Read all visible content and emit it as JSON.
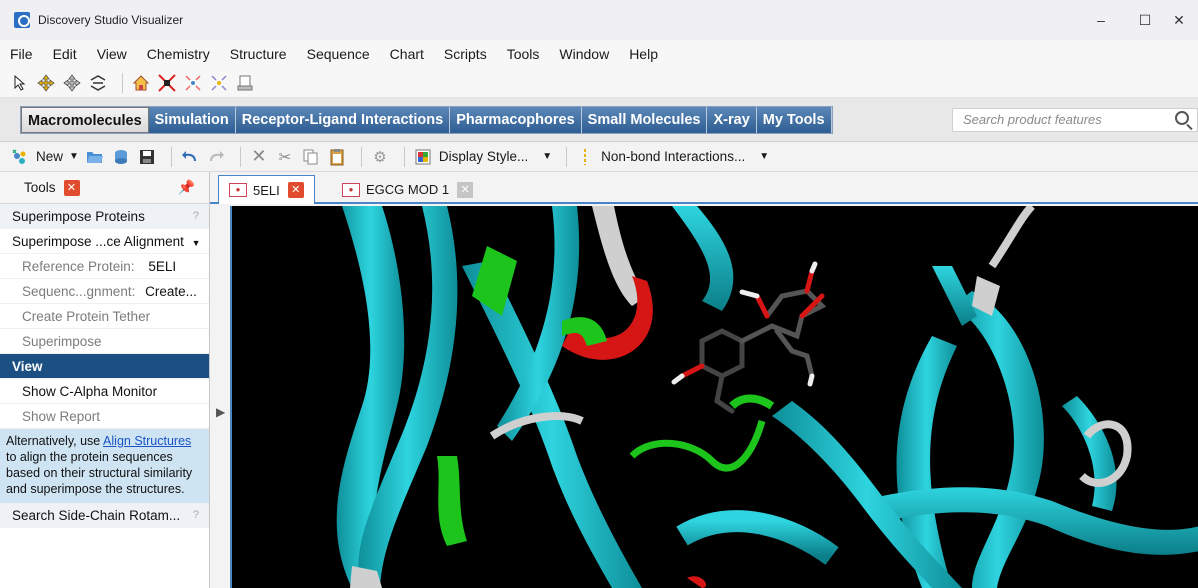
{
  "window": {
    "title": "Discovery Studio Visualizer"
  },
  "window_controls": {
    "minimize": "–",
    "maximize": "☐",
    "close": "✕"
  },
  "menu": [
    "File",
    "Edit",
    "View",
    "Chemistry",
    "Structure",
    "Sequence",
    "Chart",
    "Scripts",
    "Tools",
    "Window",
    "Help"
  ],
  "ribbon": {
    "tabs": [
      "Macromolecules",
      "Simulation",
      "Receptor-Ligand Interactions",
      "Pharmacophores",
      "Small Molecules",
      "X-ray",
      "My Tools"
    ],
    "active_tab": "Macromolecules",
    "search_placeholder": "Search product features"
  },
  "toolbar": {
    "new_label": "New",
    "display_style_label": "Display Style...",
    "nonbond_label": "Non-bond Interactions..."
  },
  "tools_panel": {
    "title": "Tools",
    "section_title": "Superimpose Proteins",
    "method_select": "Superimpose ...ce Alignment",
    "reference_label": "Reference Protein:",
    "reference_value": "5ELI",
    "sequence_label": "Sequenc...gnment:",
    "sequence_value": "Create...",
    "create_tether": "Create Protein Tether",
    "superimpose": "Superimpose",
    "view": "View",
    "show_monitor": "Show C-Alpha Monitor",
    "show_report": "Show Report",
    "tip_prefix": "Alternatively, use ",
    "tip_link": "Align Structures",
    "tip_suffix": " to align the protein sequences based on their structural similarity and superimpose the structures.",
    "next_section": "Search Side-Chain Rotam...",
    "help_mark": "?"
  },
  "documents": {
    "tabs": [
      "5ELI",
      "EGCG MOD 1"
    ],
    "active": "5ELI"
  },
  "colors": {
    "ribbon_blue": "#2e5d92",
    "selected_row": "#1c4f82",
    "helix_cyan": "#20c4cf",
    "coil_green": "#1cc41c",
    "helix_red": "#d61515",
    "loop_white": "#cfcfcf",
    "background": "#000000"
  }
}
